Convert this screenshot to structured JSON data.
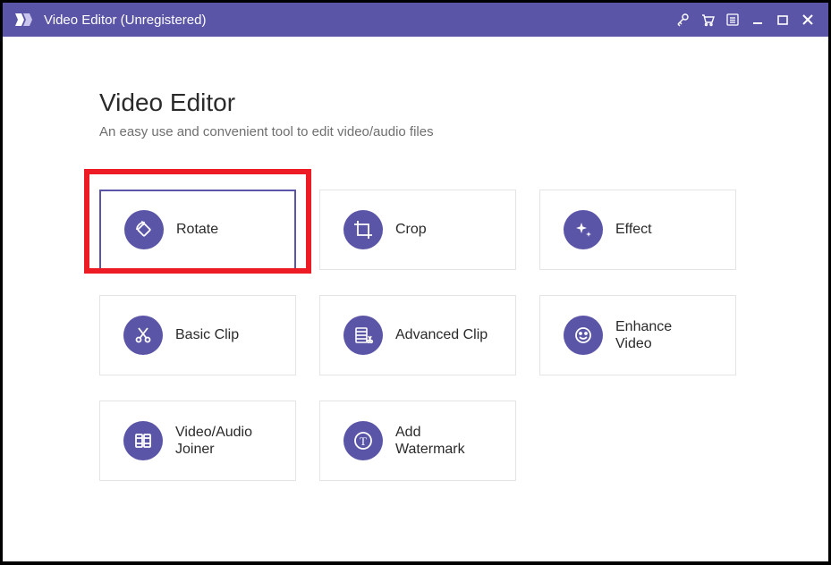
{
  "window": {
    "title": "Video Editor (Unregistered)"
  },
  "header": {
    "title": "Video Editor",
    "subtitle": "An easy use and convenient tool to edit video/audio files"
  },
  "tiles": {
    "rotate": "Rotate",
    "crop": "Crop",
    "effect": "Effect",
    "basic_clip": "Basic Clip",
    "advanced_clip": "Advanced Clip",
    "enhance_video": "Enhance\nVideo",
    "joiner": "Video/Audio\nJoiner",
    "watermark": "Add\nWatermark"
  },
  "colors": {
    "accent": "#5b55a7",
    "highlight": "#ed1c24"
  }
}
